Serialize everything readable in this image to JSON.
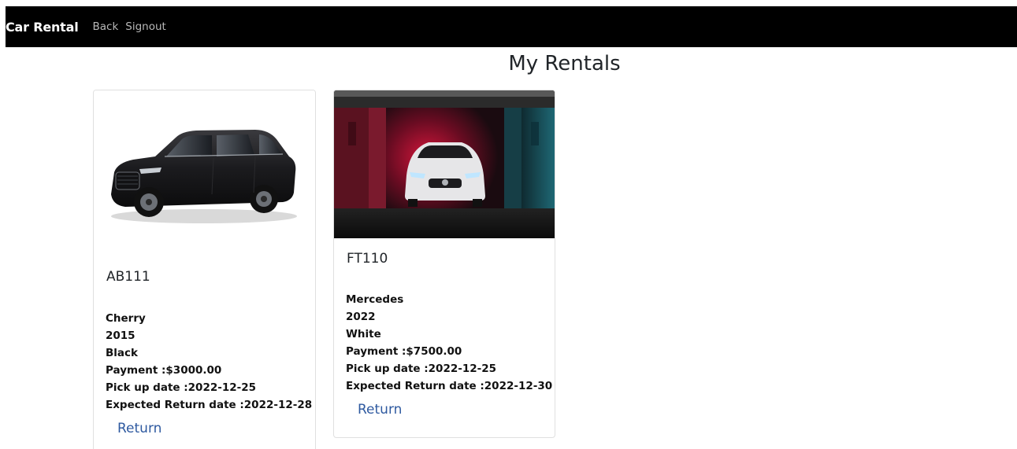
{
  "navbar": {
    "brand": "Car Rental",
    "links": [
      "Back",
      "Signout"
    ]
  },
  "page": {
    "title": "My Rentals"
  },
  "rentals": [
    {
      "plate": "AB111",
      "make": "Cherry",
      "year": "2015",
      "color": "Black",
      "payment": "Payment :$3000.00",
      "pickup": "Pick up date :2022-12-25",
      "expected_return": "Expected Return date :2022-12-28",
      "action": "Return"
    },
    {
      "plate": "FT110",
      "make": "Mercedes",
      "year": "2022",
      "color": "White",
      "payment": "Payment :$7500.00",
      "pickup": "Pick up date :2022-12-25",
      "expected_return": "Expected Return date :2022-12-30",
      "action": "Return"
    }
  ]
}
